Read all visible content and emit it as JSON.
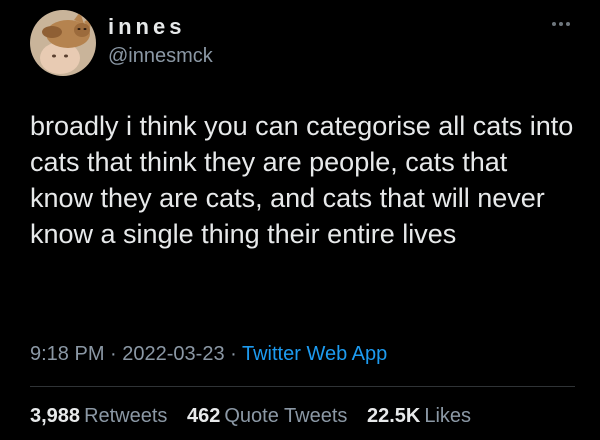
{
  "author": {
    "display_name": "innes",
    "handle": "@innesmck",
    "avatar": "avatar-person-with-cat"
  },
  "more_icon": "more-horizontal-icon",
  "tweet": {
    "text": "broadly i think you can categorise all cats into cats that think they are people, cats that know they are cats, and cats that will never know a single thing their entire lives"
  },
  "meta": {
    "time": "9:18 PM",
    "separator": " · ",
    "date": "2022-03-23",
    "source": "Twitter Web App"
  },
  "stats": {
    "retweets": {
      "count": "3,988",
      "label": "Retweets"
    },
    "quote_tweets": {
      "count": "462",
      "label": "Quote Tweets"
    },
    "likes": {
      "count": "22.5K",
      "label": "Likes"
    }
  },
  "colors": {
    "background": "#000000",
    "primary_text": "#e7e9ea",
    "secondary_text": "#8b98a5",
    "link": "#1d9bf0"
  }
}
